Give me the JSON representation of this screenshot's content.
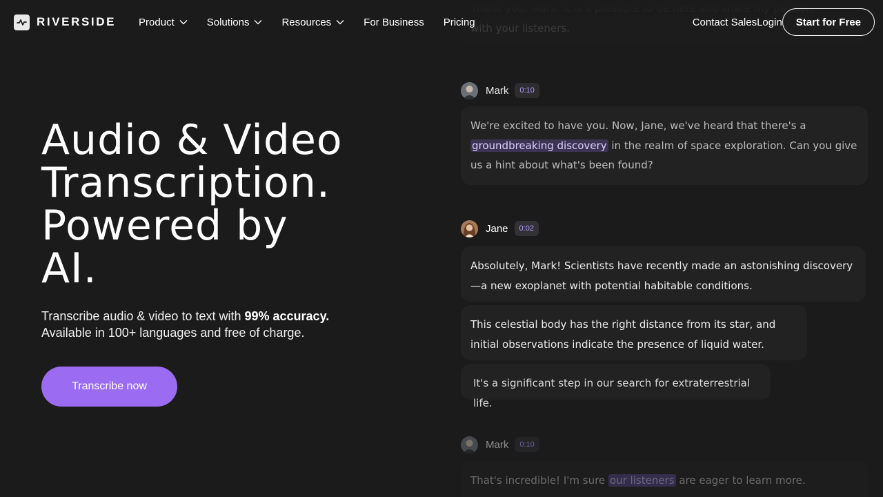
{
  "nav": {
    "brand": "RIVERSIDE",
    "links": [
      {
        "label": "Product",
        "has_menu": true
      },
      {
        "label": "Solutions",
        "has_menu": true
      },
      {
        "label": "Resources",
        "has_menu": true
      },
      {
        "label": "For Business",
        "has_menu": false
      },
      {
        "label": "Pricing",
        "has_menu": false
      }
    ],
    "contact_label": "Contact Sales",
    "login_label": "Login",
    "cta_label": "Start for Free"
  },
  "hero": {
    "title_lines": [
      "Audio & Video",
      "Transcription.",
      "Powered by",
      "AI."
    ],
    "subtitle_pre": "Transcribe audio & video to text with ",
    "subtitle_bold": "99% accuracy.",
    "subtitle_post": "Available in 100+ languages and free of charge.",
    "button_label": "Transcribe now"
  },
  "transcript": {
    "top_fragment_1": "Thank you, Mark. It is a pleasure to be here and share my passion",
    "top_fragment_2": "with your listeners.",
    "messages": [
      {
        "speaker": "Mark",
        "time": "0:10",
        "pre": "We're excited to have you. Now, Jane, we've heard that there's a",
        "highlight": "groundbreaking discovery",
        "post": "in the realm of space exploration. Can you give us a hint about what's been found?"
      },
      {
        "speaker": "Jane",
        "time": "0:02",
        "paragraphs": [
          "Absolutely, Mark! Scientists have recently made an astonishing discovery—a new exoplanet with potential habitable conditions.",
          " This celestial body has the right distance from its star, and initial observations indicate the presence of liquid water.",
          " It's a significant step in our search for extraterrestrial life."
        ]
      },
      {
        "speaker": "Mark",
        "time": "0:10",
        "pre": "That's incredible! I'm sure",
        "highlight": "our listeners",
        "post": "are eager to learn more."
      }
    ]
  },
  "colors": {
    "background": "#1b1b1c",
    "accent": "#9b6cf2",
    "bubble": "#222223",
    "highlight": "#3d3454",
    "badge_text": "#b59cff"
  },
  "icons": {
    "logo": "waveform-icon",
    "menu": "chevron-down-icon",
    "mark_avatar": "avatar-mark",
    "jane_avatar": "avatar-jane"
  }
}
